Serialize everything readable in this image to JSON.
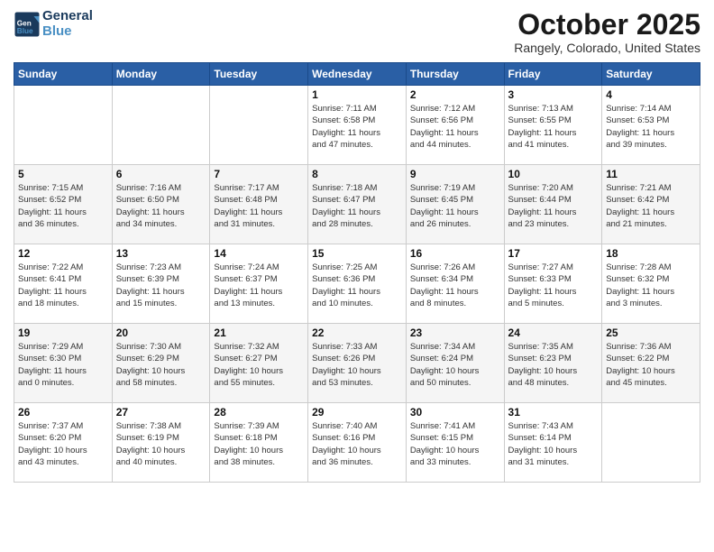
{
  "header": {
    "logo_line1": "General",
    "logo_line2": "Blue",
    "month": "October 2025",
    "location": "Rangely, Colorado, United States"
  },
  "days_of_week": [
    "Sunday",
    "Monday",
    "Tuesday",
    "Wednesday",
    "Thursday",
    "Friday",
    "Saturday"
  ],
  "weeks": [
    [
      {
        "day": "",
        "info": ""
      },
      {
        "day": "",
        "info": ""
      },
      {
        "day": "",
        "info": ""
      },
      {
        "day": "1",
        "info": "Sunrise: 7:11 AM\nSunset: 6:58 PM\nDaylight: 11 hours\nand 47 minutes."
      },
      {
        "day": "2",
        "info": "Sunrise: 7:12 AM\nSunset: 6:56 PM\nDaylight: 11 hours\nand 44 minutes."
      },
      {
        "day": "3",
        "info": "Sunrise: 7:13 AM\nSunset: 6:55 PM\nDaylight: 11 hours\nand 41 minutes."
      },
      {
        "day": "4",
        "info": "Sunrise: 7:14 AM\nSunset: 6:53 PM\nDaylight: 11 hours\nand 39 minutes."
      }
    ],
    [
      {
        "day": "5",
        "info": "Sunrise: 7:15 AM\nSunset: 6:52 PM\nDaylight: 11 hours\nand 36 minutes."
      },
      {
        "day": "6",
        "info": "Sunrise: 7:16 AM\nSunset: 6:50 PM\nDaylight: 11 hours\nand 34 minutes."
      },
      {
        "day": "7",
        "info": "Sunrise: 7:17 AM\nSunset: 6:48 PM\nDaylight: 11 hours\nand 31 minutes."
      },
      {
        "day": "8",
        "info": "Sunrise: 7:18 AM\nSunset: 6:47 PM\nDaylight: 11 hours\nand 28 minutes."
      },
      {
        "day": "9",
        "info": "Sunrise: 7:19 AM\nSunset: 6:45 PM\nDaylight: 11 hours\nand 26 minutes."
      },
      {
        "day": "10",
        "info": "Sunrise: 7:20 AM\nSunset: 6:44 PM\nDaylight: 11 hours\nand 23 minutes."
      },
      {
        "day": "11",
        "info": "Sunrise: 7:21 AM\nSunset: 6:42 PM\nDaylight: 11 hours\nand 21 minutes."
      }
    ],
    [
      {
        "day": "12",
        "info": "Sunrise: 7:22 AM\nSunset: 6:41 PM\nDaylight: 11 hours\nand 18 minutes."
      },
      {
        "day": "13",
        "info": "Sunrise: 7:23 AM\nSunset: 6:39 PM\nDaylight: 11 hours\nand 15 minutes."
      },
      {
        "day": "14",
        "info": "Sunrise: 7:24 AM\nSunset: 6:37 PM\nDaylight: 11 hours\nand 13 minutes."
      },
      {
        "day": "15",
        "info": "Sunrise: 7:25 AM\nSunset: 6:36 PM\nDaylight: 11 hours\nand 10 minutes."
      },
      {
        "day": "16",
        "info": "Sunrise: 7:26 AM\nSunset: 6:34 PM\nDaylight: 11 hours\nand 8 minutes."
      },
      {
        "day": "17",
        "info": "Sunrise: 7:27 AM\nSunset: 6:33 PM\nDaylight: 11 hours\nand 5 minutes."
      },
      {
        "day": "18",
        "info": "Sunrise: 7:28 AM\nSunset: 6:32 PM\nDaylight: 11 hours\nand 3 minutes."
      }
    ],
    [
      {
        "day": "19",
        "info": "Sunrise: 7:29 AM\nSunset: 6:30 PM\nDaylight: 11 hours\nand 0 minutes."
      },
      {
        "day": "20",
        "info": "Sunrise: 7:30 AM\nSunset: 6:29 PM\nDaylight: 10 hours\nand 58 minutes."
      },
      {
        "day": "21",
        "info": "Sunrise: 7:32 AM\nSunset: 6:27 PM\nDaylight: 10 hours\nand 55 minutes."
      },
      {
        "day": "22",
        "info": "Sunrise: 7:33 AM\nSunset: 6:26 PM\nDaylight: 10 hours\nand 53 minutes."
      },
      {
        "day": "23",
        "info": "Sunrise: 7:34 AM\nSunset: 6:24 PM\nDaylight: 10 hours\nand 50 minutes."
      },
      {
        "day": "24",
        "info": "Sunrise: 7:35 AM\nSunset: 6:23 PM\nDaylight: 10 hours\nand 48 minutes."
      },
      {
        "day": "25",
        "info": "Sunrise: 7:36 AM\nSunset: 6:22 PM\nDaylight: 10 hours\nand 45 minutes."
      }
    ],
    [
      {
        "day": "26",
        "info": "Sunrise: 7:37 AM\nSunset: 6:20 PM\nDaylight: 10 hours\nand 43 minutes."
      },
      {
        "day": "27",
        "info": "Sunrise: 7:38 AM\nSunset: 6:19 PM\nDaylight: 10 hours\nand 40 minutes."
      },
      {
        "day": "28",
        "info": "Sunrise: 7:39 AM\nSunset: 6:18 PM\nDaylight: 10 hours\nand 38 minutes."
      },
      {
        "day": "29",
        "info": "Sunrise: 7:40 AM\nSunset: 6:16 PM\nDaylight: 10 hours\nand 36 minutes."
      },
      {
        "day": "30",
        "info": "Sunrise: 7:41 AM\nSunset: 6:15 PM\nDaylight: 10 hours\nand 33 minutes."
      },
      {
        "day": "31",
        "info": "Sunrise: 7:43 AM\nSunset: 6:14 PM\nDaylight: 10 hours\nand 31 minutes."
      },
      {
        "day": "",
        "info": ""
      }
    ]
  ]
}
